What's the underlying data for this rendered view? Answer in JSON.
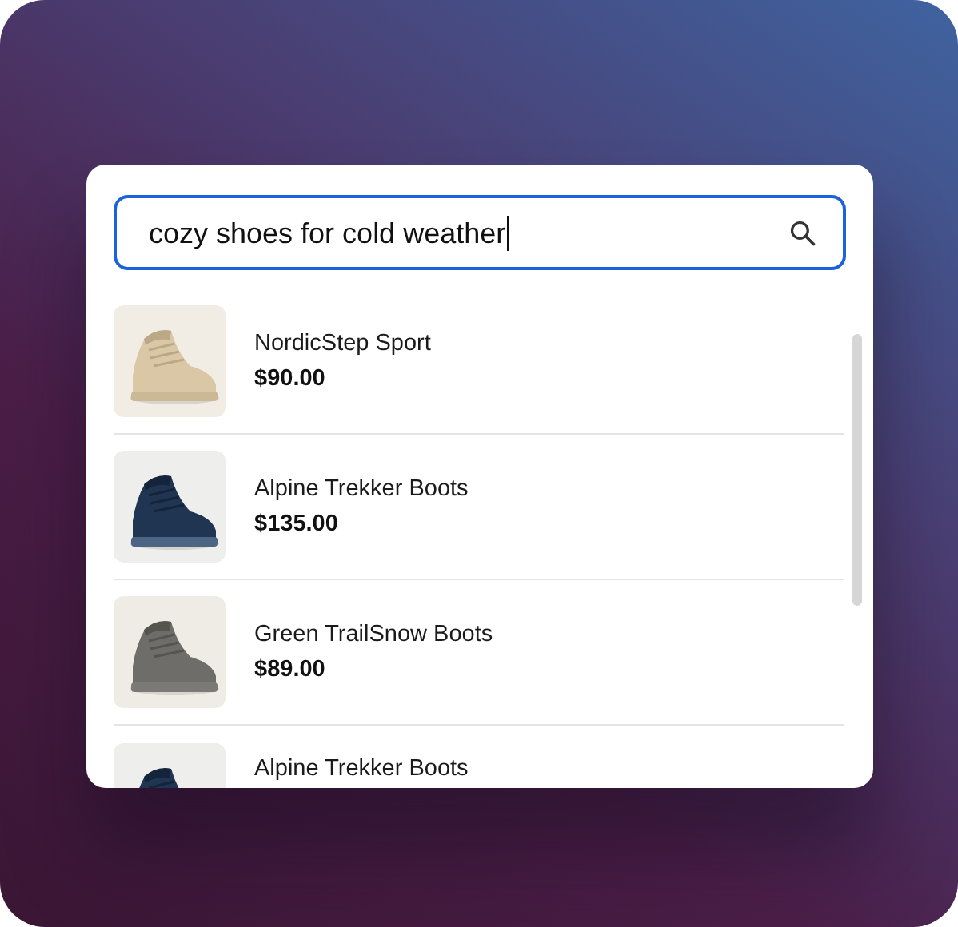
{
  "search": {
    "value": "cozy shoes for cold weather"
  },
  "results": [
    {
      "name": "NordicStep Sport",
      "price": "$90.00"
    },
    {
      "name": "Alpine Trekker Boots",
      "price": "$135.00"
    },
    {
      "name": "Green TrailSnow Boots",
      "price": "$89.00"
    },
    {
      "name": "Alpine Trekker Boots"
    }
  ]
}
